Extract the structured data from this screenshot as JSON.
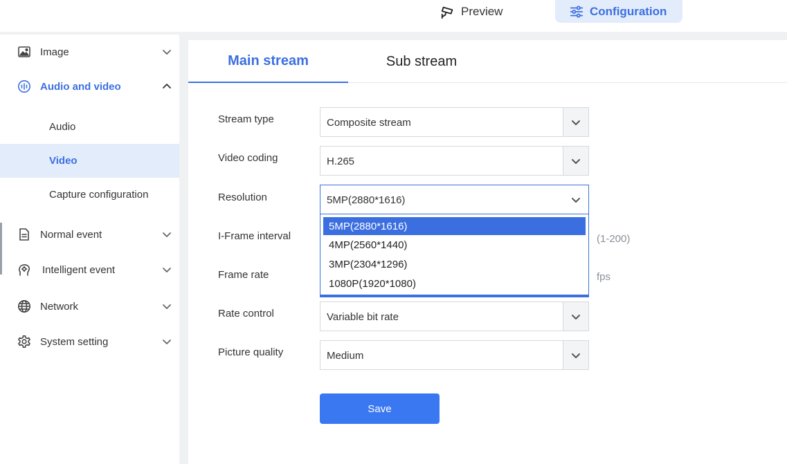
{
  "top_nav": {
    "preview_label": "Preview",
    "configuration_label": "Configuration"
  },
  "sidebar": {
    "items": [
      {
        "label": "Image",
        "icon": "image-icon"
      },
      {
        "label": "Audio and video",
        "icon": "audio-video-icon",
        "expanded": true,
        "children": [
          {
            "label": "Audio"
          },
          {
            "label": "Video",
            "active": true
          },
          {
            "label": "Capture configuration"
          }
        ]
      },
      {
        "label": "Normal event",
        "icon": "document-icon"
      },
      {
        "label": "Intelligent event",
        "icon": "brain-icon"
      },
      {
        "label": "Network",
        "icon": "globe-icon"
      },
      {
        "label": "System setting",
        "icon": "gear-icon"
      }
    ]
  },
  "stream_tabs": {
    "main": "Main stream",
    "sub": "Sub stream"
  },
  "form": {
    "stream_type": {
      "label": "Stream type",
      "value": "Composite stream"
    },
    "video_coding": {
      "label": "Video coding",
      "value": "H.265"
    },
    "resolution": {
      "label": "Resolution",
      "value": "5MP(2880*1616)",
      "options": [
        "5MP(2880*1616)",
        "4MP(2560*1440)",
        "3MP(2304*1296)",
        "1080P(1920*1080)"
      ]
    },
    "iframe_interval": {
      "label": "I-Frame interval",
      "hint": "(1-200)"
    },
    "frame_rate": {
      "label": "Frame rate",
      "hint": "fps"
    },
    "rate_control": {
      "label": "Rate control",
      "value": "Variable bit rate"
    },
    "picture_quality": {
      "label": "Picture quality",
      "value": "Medium"
    }
  },
  "save_label": "Save",
  "colors": {
    "accent": "#3b6fe0",
    "button": "#3a78f2",
    "active_bg": "#e3ecfb"
  }
}
